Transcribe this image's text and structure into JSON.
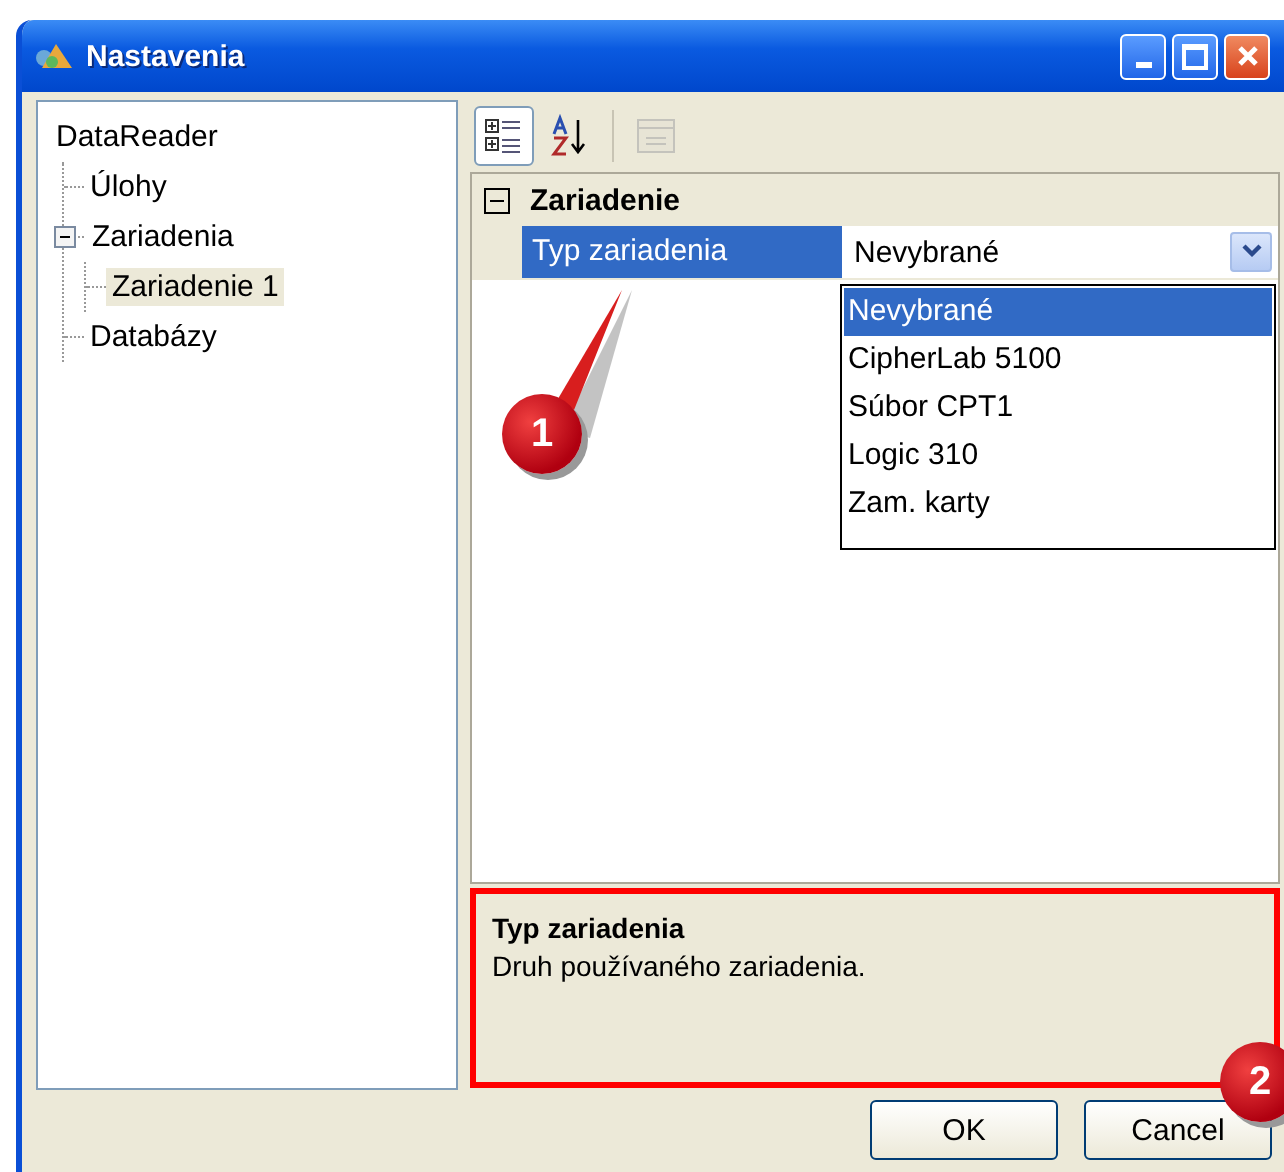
{
  "window": {
    "title": "Nastavenia"
  },
  "tree": {
    "label": "DataReader",
    "selected": false,
    "children": [
      {
        "label": "Úlohy",
        "selected": false
      },
      {
        "label": "Zariadenia",
        "selected": false,
        "expanded": true,
        "children": [
          {
            "label": "Zariadenie 1",
            "selected": true
          }
        ]
      },
      {
        "label": "Databázy",
        "selected": false
      }
    ]
  },
  "toolbar": [
    {
      "kind": "categorized",
      "selected": true,
      "disabled": false
    },
    {
      "kind": "alphabetical",
      "selected": false,
      "disabled": false
    },
    {
      "kind": "pages",
      "selected": false,
      "disabled": true
    }
  ],
  "property_grid": {
    "category": {
      "label": "Zariadenie",
      "expanded": true
    },
    "properties": [
      {
        "name": "Typ zariadenia",
        "value": "Nevybrané",
        "selected": true
      }
    ],
    "dropdown": {
      "options": [
        {
          "label": "Nevybrané",
          "selected": true
        },
        {
          "label": "CipherLab 5100",
          "selected": false
        },
        {
          "label": "Súbor CPT1",
          "selected": false
        },
        {
          "label": "Logic 310",
          "selected": false
        },
        {
          "label": "Zam. karty",
          "selected": false
        }
      ]
    }
  },
  "description": {
    "title": "Typ zariadenia",
    "text": "Druh používaného zariadenia."
  },
  "buttons": [
    "OK",
    "Cancel"
  ],
  "annotations": [
    "1",
    "2"
  ]
}
